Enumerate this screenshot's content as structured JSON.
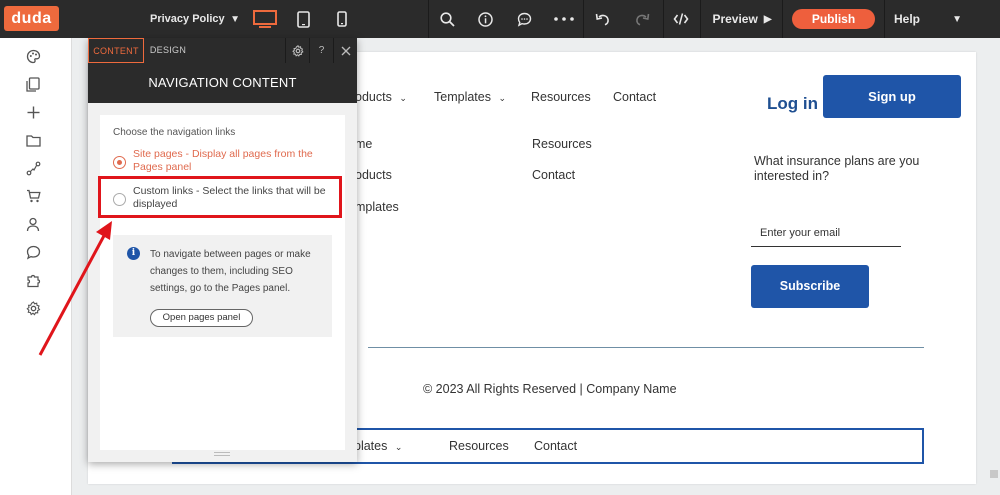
{
  "topbar": {
    "logo": "duda",
    "page_selector": "Privacy Policy",
    "preview_label": "Preview",
    "publish_label": "Publish",
    "help_label": "Help"
  },
  "panel": {
    "tab_content": "CONTENT",
    "tab_design": "DESIGN",
    "help_glyph": "?",
    "title": "NAVIGATION CONTENT",
    "choose_label": "Choose the navigation links",
    "option_site_pages": "Site pages - Display all pages from the Pages panel",
    "option_custom_links": "Custom links - Select the links that will be displayed",
    "info_text": "To navigate between pages or make changes to them, including SEO settings, go to the Pages panel.",
    "open_pages_button": "Open pages panel"
  },
  "site": {
    "nav_products": "oducts",
    "nav_templates": "Templates",
    "nav_resources": "Resources",
    "nav_contact": "Contact",
    "login_label": "Log in",
    "signup_label": "Sign up",
    "footer_col1": [
      "me",
      "oducts",
      "mplates"
    ],
    "footer_col2": [
      "Resources",
      "Contact"
    ],
    "question": "What insurance plans are you interested in?",
    "email_placeholder": "Enter your email",
    "subscribe_label": "Subscribe",
    "copyright": "© 2023 All Rights Reserved | Company Name",
    "bottom_templates": "plates",
    "bottom_resources": "Resources",
    "bottom_contact": "Contact"
  },
  "colors": {
    "brand_orange": "#ee6a3d",
    "topbar_dark": "#2b2b2b",
    "button_blue": "#1f55a8",
    "highlight_red": "#e0151b"
  }
}
